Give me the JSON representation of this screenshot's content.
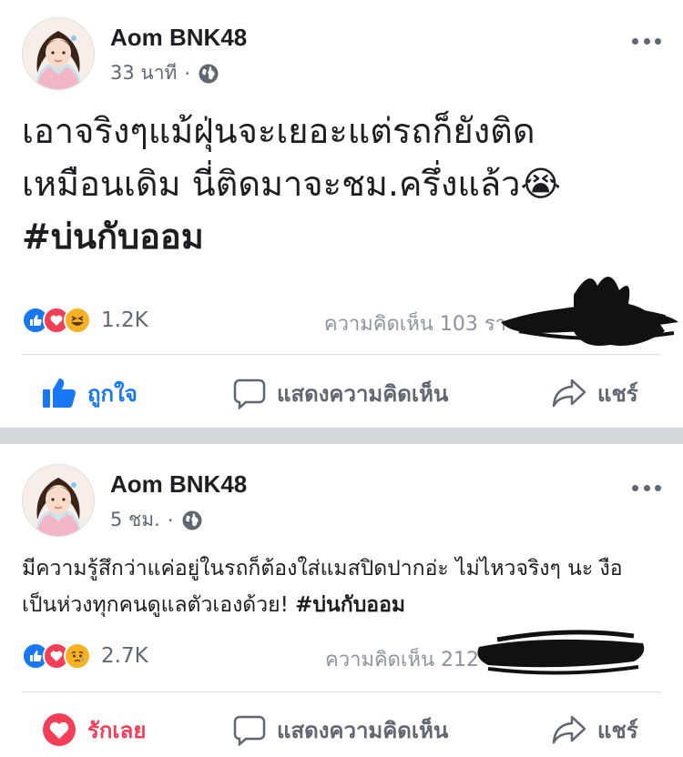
{
  "posts": [
    {
      "author": "Aom BNK48",
      "time": "33 นาที",
      "dot": "·",
      "text_line1": "เอาจริงๆแม้ฝุ่นจะเยอะแต่รถก็ยังติด",
      "text_line2": "เหมือนเดิม นี่ติดมาจะชม.ครึ่งแล้ว😭",
      "hashtag": "#บ่นกับออม",
      "reaction_count": "1.2K",
      "comments_label": "ความคิดเห็น 103 รา",
      "actions": {
        "like": "ถูกใจ",
        "comment": "แสดงความคิดเห็น",
        "share": "แชร์"
      },
      "liked": true
    },
    {
      "author": "Aom BNK48",
      "time": "5 ชม.",
      "dot": "·",
      "text": "มีความรู้สึกว่าแค่อยู่ในรถก็ต้องใส่แมสปิดปากอ่ะ ไม่ไหวจริงๆ นะ งือ เป็นห่วงทุกคนดูแลตัวเองด้วย! ",
      "hashtag": "#บ่นกับออม",
      "reaction_count": "2.7K",
      "comments_label": "ความคิดเห็น 212",
      "actions": {
        "like": "รักเลย",
        "comment": "แสดงความคิดเห็น",
        "share": "แชร์"
      }
    }
  ],
  "colors": {
    "like_blue": "#1877f2",
    "love_red": "#f33e58",
    "haha_yellow": "#f7b125",
    "separator_gray": "#d4d7dc"
  }
}
